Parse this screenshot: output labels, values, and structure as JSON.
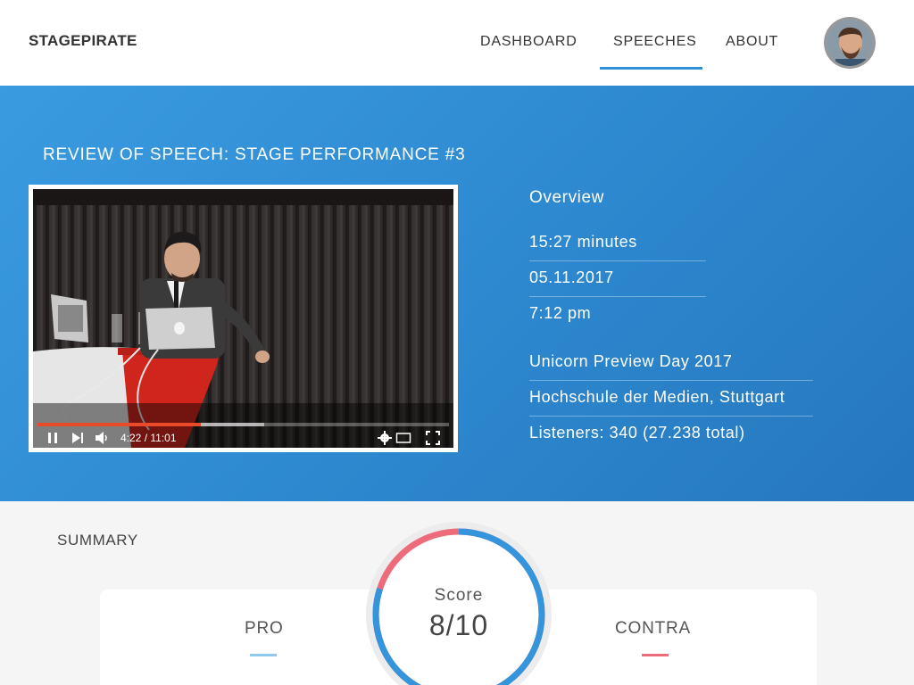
{
  "header": {
    "brand": "STAGEPIRATE",
    "nav": [
      {
        "label": "DASHBOARD",
        "active": false
      },
      {
        "label": "SPEECHES",
        "active": true
      },
      {
        "label": "ABOUT",
        "active": false
      }
    ],
    "accent_color": "#2f8fd8"
  },
  "hero": {
    "title": "REVIEW OF SPEECH: STAGE PERFORMANCE #3",
    "background_color": "#2f8fd8",
    "video": {
      "time_display": "4:22 / 11:01",
      "progress_fraction": 0.396,
      "buffered_fraction": 0.55,
      "progress_color": "#e84a2a",
      "controls": [
        "pause-icon",
        "next-icon",
        "volume-icon",
        "settings-icon",
        "theater-icon",
        "fullscreen-icon"
      ]
    },
    "overview": {
      "title": "Overview",
      "duration": "15:27 minutes",
      "date": "05.11.2017",
      "time": "7:12 pm",
      "event": "Unicorn Preview Day 2017",
      "location": "Hochschule der Medien, Stuttgart",
      "listeners": "Listeners: 340 (27.238 total)"
    }
  },
  "summary": {
    "title": "SUMMARY",
    "pro_label": "PRO",
    "contra_label": "CONTRA",
    "score_label": "Score",
    "score_value": "8/10",
    "score_fraction": 0.8,
    "pro_color": "#90c8ee",
    "contra_color": "#ee6b7c"
  }
}
